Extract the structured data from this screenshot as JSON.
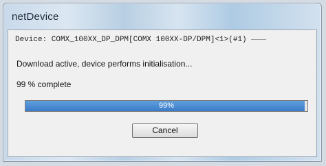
{
  "window": {
    "title": "netDevice"
  },
  "dialog": {
    "device_line": "Device: COMX_100XX_DP_DPM[COMX 100XX-DP/DPM]<1>(#1)",
    "status_text": "Download active, device performs initialisation...",
    "percent_text": "99 % complete",
    "progress": {
      "value_percent": 99,
      "label": "99%",
      "fill_color": "#3a7bc8"
    },
    "cancel_label": "Cancel"
  }
}
